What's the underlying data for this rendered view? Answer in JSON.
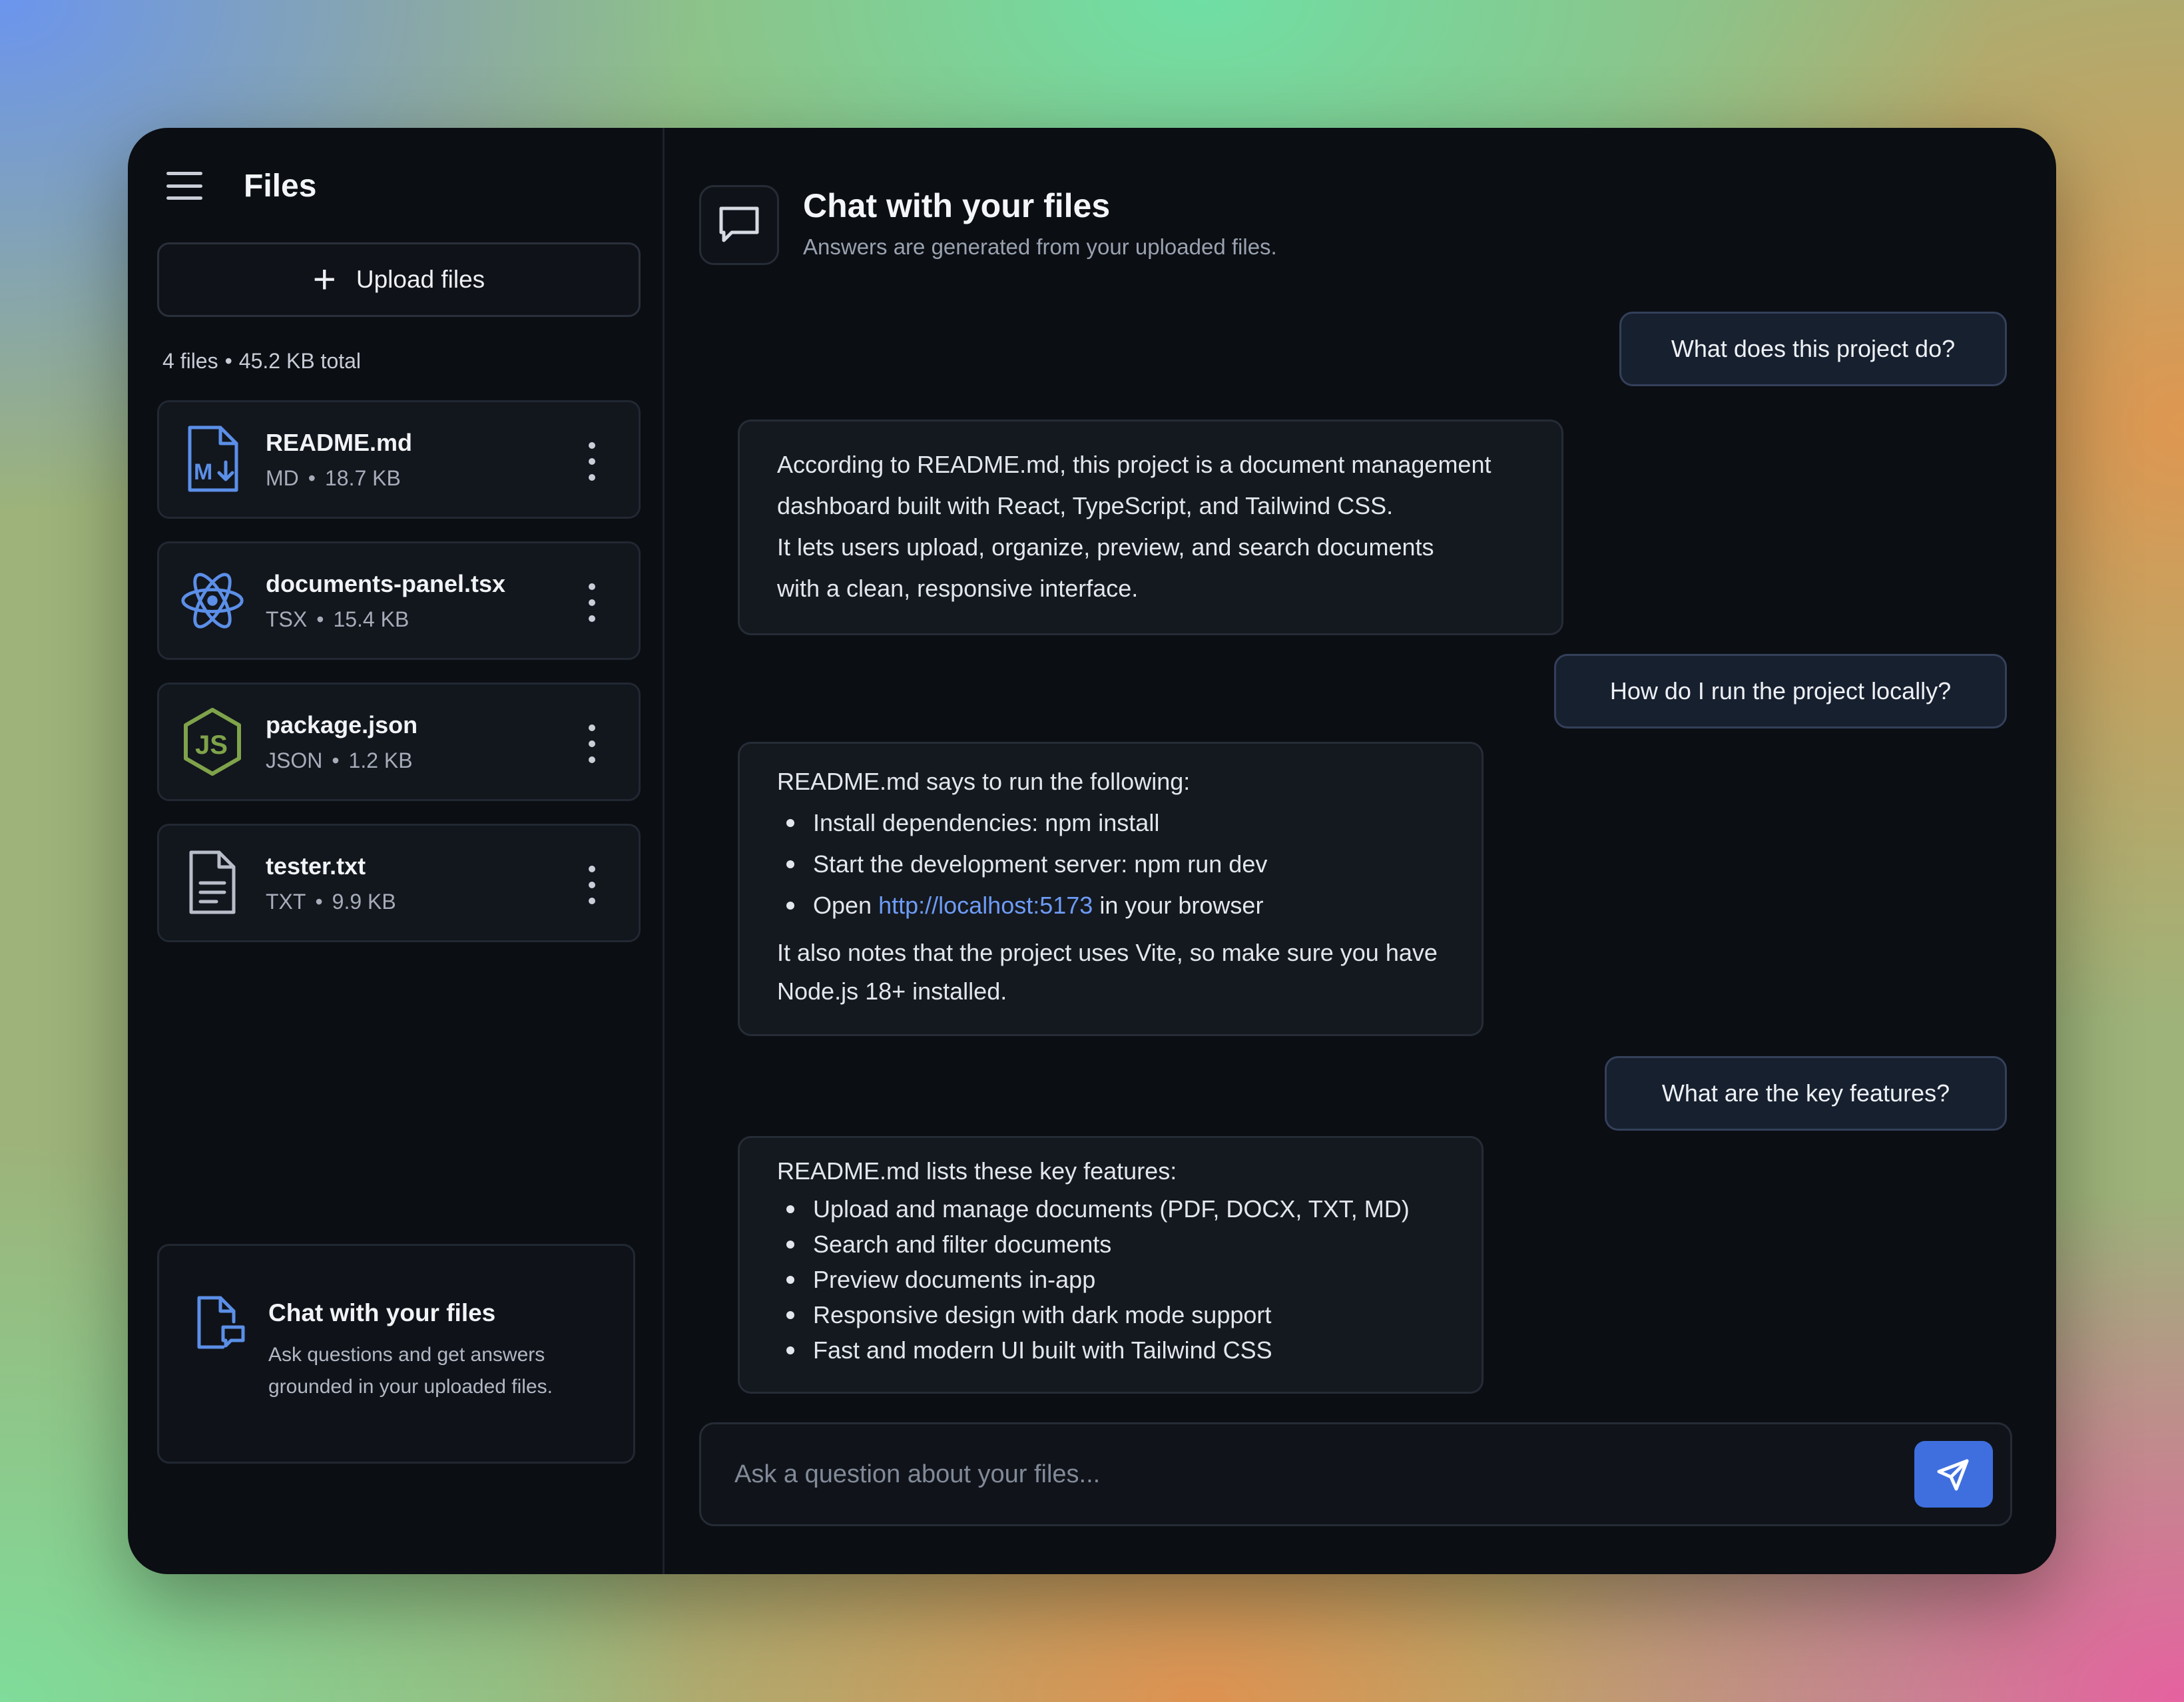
{
  "sidebar": {
    "title": "Files",
    "upload_label": "Upload files",
    "file_count": "4 files",
    "total_size": "45.2 KB total",
    "files": [
      {
        "name": "README.md",
        "type": "MD",
        "size": "18.7 KB",
        "icon": "markdown-icon"
      },
      {
        "name": "documents-panel.tsx",
        "type": "TSX",
        "size": "15.4 KB",
        "icon": "react-icon"
      },
      {
        "name": "package.json",
        "type": "JSON",
        "size": "1.2 KB",
        "icon": "nodejs-icon"
      },
      {
        "name": "tester.txt",
        "type": "TXT",
        "size": "9.9 KB",
        "icon": "text-file-icon"
      }
    ],
    "promo": {
      "title": "Chat with your files",
      "description": "Ask questions and get answers grounded in your uploaded files."
    }
  },
  "chat": {
    "title": "Chat with your files",
    "subtitle": "Answers are generated from your uploaded files.",
    "messages": [
      {
        "role": "user",
        "text": "What does this project do?"
      },
      {
        "role": "assistant",
        "lines": [
          "According to README.md, this project is a document management",
          "dashboard built with React, TypeScript, and Tailwind CSS.",
          "It lets users upload, organize, preview, and search documents",
          "with a clean, responsive interface."
        ]
      },
      {
        "role": "user",
        "text": "How do I run the project locally?"
      },
      {
        "role": "assistant",
        "intro": "README.md says to run the following:",
        "steps": [
          "Install dependencies: npm install",
          "Start the development server: npm run dev"
        ],
        "open_prefix": "Open",
        "open_link": "http://localhost:5173",
        "open_suffix": "in your browser",
        "note_lines": [
          "It also notes that the project uses Vite, so make sure you have",
          "Node.js 18+ installed."
        ]
      },
      {
        "role": "user",
        "text": "What are the key features?"
      },
      {
        "role": "assistant",
        "intro": "README.md lists these key features:",
        "features": [
          "Upload and manage documents (PDF, DOCX, TXT, MD)",
          "Search and filter documents",
          "Preview documents in-app",
          "Responsive design with dark mode support",
          "Fast and modern UI built with Tailwind CSS"
        ]
      }
    ],
    "composer_placeholder": "Ask a question about your files..."
  },
  "colors": {
    "accent": "#3f6fdf",
    "link": "#6d9cf6",
    "window_bg": "#0b0e13"
  }
}
